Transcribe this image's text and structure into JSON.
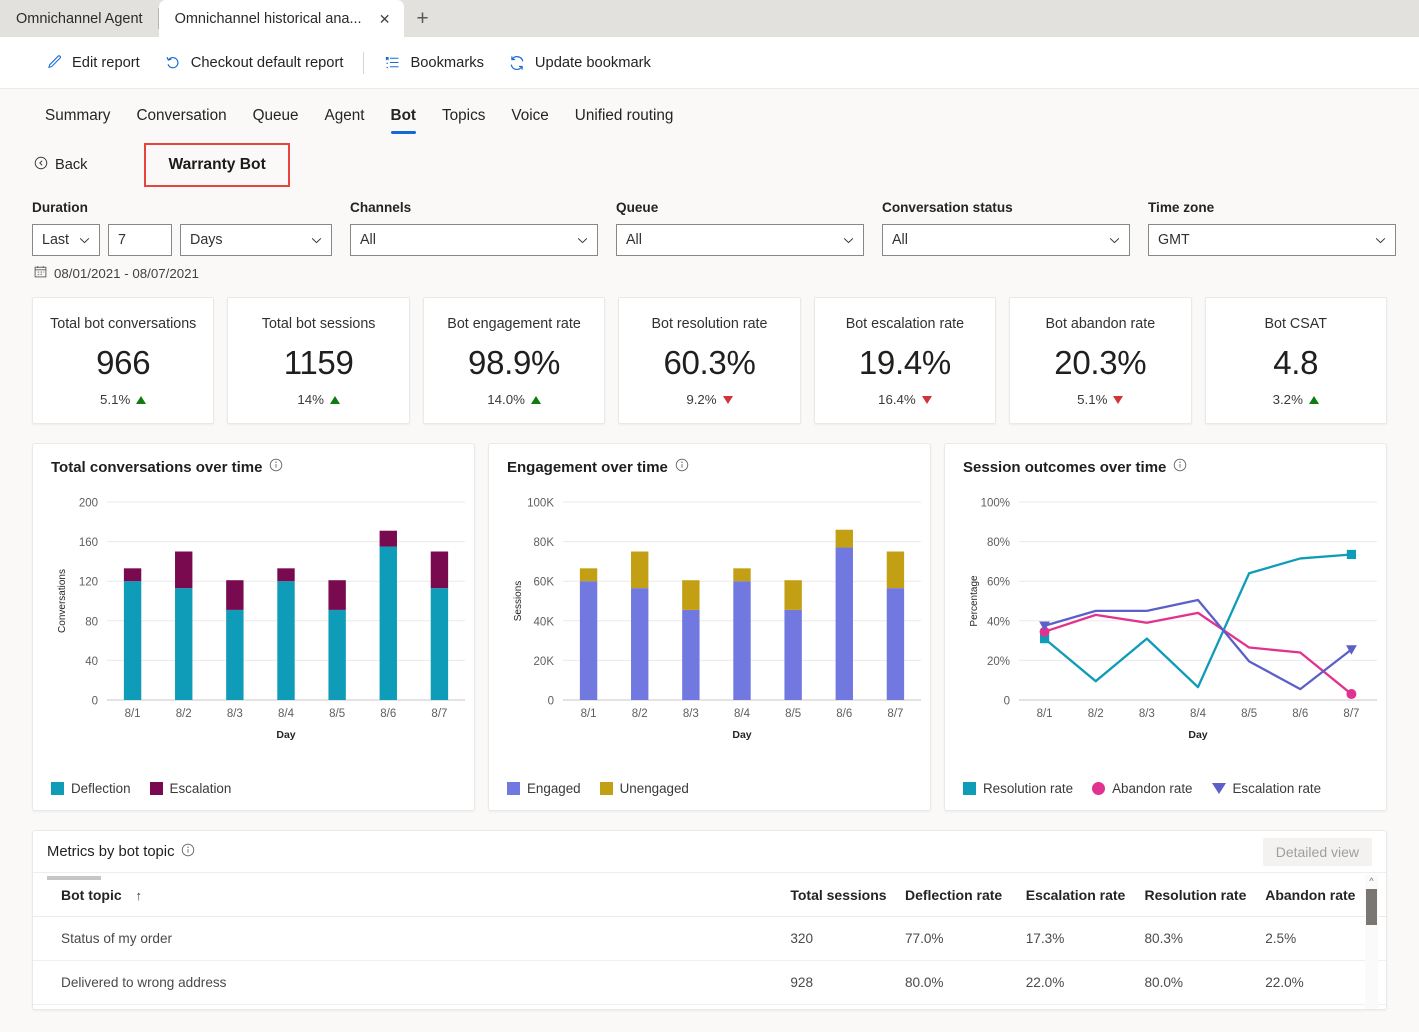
{
  "browser": {
    "tabs": [
      {
        "title": "Omnichannel Agent",
        "active": false
      },
      {
        "title": "Omnichannel historical ana...",
        "active": true
      }
    ],
    "close_label": "✕",
    "newtab_label": "+"
  },
  "command_bar": {
    "items": [
      {
        "label": "Edit report",
        "icon": "pencil-icon"
      },
      {
        "label": "Checkout default report",
        "icon": "undo-icon"
      },
      {
        "label": "Bookmarks",
        "icon": "bookmark-list-icon"
      },
      {
        "label": "Update bookmark",
        "icon": "refresh-icon"
      }
    ]
  },
  "nav_tabs": [
    {
      "label": "Summary",
      "selected": false
    },
    {
      "label": "Conversation",
      "selected": false
    },
    {
      "label": "Queue",
      "selected": false
    },
    {
      "label": "Agent",
      "selected": false
    },
    {
      "label": "Bot",
      "selected": true
    },
    {
      "label": "Topics",
      "selected": false
    },
    {
      "label": "Voice",
      "selected": false
    },
    {
      "label": "Unified routing",
      "selected": false
    }
  ],
  "breadcrumb": {
    "back_label": "Back",
    "bot_name": "Warranty Bot",
    "highlight_color": "#e8443f"
  },
  "filters": {
    "duration": {
      "label": "Duration",
      "mode": "Last",
      "amount": "7",
      "unit": "Days",
      "date_range": "08/01/2021 - 08/07/2021"
    },
    "channels": {
      "label": "Channels",
      "value": "All"
    },
    "queue": {
      "label": "Queue",
      "value": "All"
    },
    "conversation_status": {
      "label": "Conversation status",
      "value": "All"
    },
    "time_zone": {
      "label": "Time zone",
      "value": "GMT"
    }
  },
  "kpis": [
    {
      "label": "Total bot conversations",
      "value": "966",
      "delta": "5.1%",
      "direction": "up"
    },
    {
      "label": "Total bot sessions",
      "value": "1159",
      "delta": "14%",
      "direction": "up"
    },
    {
      "label": "Bot engagement rate",
      "value": "98.9%",
      "delta": "14.0%",
      "direction": "up"
    },
    {
      "label": "Bot resolution rate",
      "value": "60.3%",
      "delta": "9.2%",
      "direction": "down"
    },
    {
      "label": "Bot escalation rate",
      "value": "19.4%",
      "delta": "16.4%",
      "direction": "down"
    },
    {
      "label": "Bot abandon rate",
      "value": "20.3%",
      "delta": "5.1%",
      "direction": "down"
    },
    {
      "label": "Bot CSAT",
      "value": "4.8",
      "delta": "3.2%",
      "direction": "up"
    }
  ],
  "colors": {
    "accent_blue": "#1668d6",
    "deflection": "#0f9cb8",
    "escalation_bar": "#7a0a50",
    "engaged": "#7178e0",
    "unengaged": "#c3a013",
    "resolution": "#0f9cb8",
    "abandon": "#e2328f",
    "escalation_line": "#5b5fc7",
    "up": "#107c10",
    "down": "#d13438"
  },
  "chart_data": [
    {
      "type": "bar",
      "stacked": true,
      "title": "Total conversations over time",
      "info_tooltip": "info-icon",
      "xlabel": "Day",
      "ylabel": "Conversations",
      "categories": [
        "8/1",
        "8/2",
        "8/3",
        "8/4",
        "8/5",
        "8/6",
        "8/7"
      ],
      "ylim": [
        0,
        200
      ],
      "yticks": [
        0,
        40,
        80,
        120,
        160,
        200
      ],
      "grid": true,
      "legend_position": "bottom-left",
      "series": [
        {
          "name": "Deflection",
          "color": "#0f9cb8",
          "values": [
            120,
            113,
            91,
            120,
            91,
            155,
            113
          ]
        },
        {
          "name": "Escalation",
          "color": "#7a0a50",
          "values": [
            13,
            37,
            30,
            13,
            30,
            16,
            37
          ]
        }
      ],
      "totals": [
        133,
        150,
        121,
        133,
        121,
        171,
        150
      ]
    },
    {
      "type": "bar",
      "stacked": true,
      "title": "Engagement over time",
      "info_tooltip": "info-icon",
      "xlabel": "Day",
      "ylabel": "Sessions",
      "categories": [
        "8/1",
        "8/2",
        "8/3",
        "8/4",
        "8/5",
        "8/6",
        "8/7"
      ],
      "ylim": [
        0,
        100000
      ],
      "yticks": [
        0,
        20000,
        40000,
        60000,
        80000,
        100000
      ],
      "ytick_labels": [
        "0",
        "20K",
        "40K",
        "60K",
        "80K",
        "100K"
      ],
      "grid": true,
      "legend_position": "bottom-left",
      "series": [
        {
          "name": "Engaged",
          "color": "#7178e0",
          "values": [
            60000,
            56500,
            45500,
            60000,
            45500,
            77000,
            56500
          ]
        },
        {
          "name": "Unengaged",
          "color": "#c3a013",
          "values": [
            6500,
            18500,
            15000,
            6500,
            15000,
            9000,
            18500
          ]
        }
      ],
      "totals": [
        66500,
        75000,
        60500,
        66500,
        60500,
        86000,
        75000
      ]
    },
    {
      "type": "line",
      "title": "Session outcomes over time",
      "info_tooltip": "info-icon",
      "xlabel": "Day",
      "ylabel": "Percentage",
      "categories": [
        "8/1",
        "8/2",
        "8/3",
        "8/4",
        "8/5",
        "8/6",
        "8/7"
      ],
      "ylim": [
        0,
        100
      ],
      "yticks": [
        0,
        20,
        40,
        60,
        80,
        100
      ],
      "ytick_labels": [
        "0",
        "20%",
        "40%",
        "60%",
        "80%",
        "100%"
      ],
      "grid": true,
      "legend_position": "bottom-left",
      "series": [
        {
          "name": "Resolution rate",
          "color": "#0f9cb8",
          "marker": "square",
          "values": [
            31,
            9.5,
            31,
            6.5,
            64,
            71.5,
            73.5
          ]
        },
        {
          "name": "Abandon rate",
          "color": "#e2328f",
          "marker": "circle",
          "values": [
            34.5,
            43,
            39,
            44,
            26.5,
            24,
            3
          ]
        },
        {
          "name": "Escalation rate",
          "color": "#5b5fc7",
          "marker": "triangle-down",
          "values": [
            37.5,
            45,
            45,
            50.5,
            19.5,
            5.5,
            25.5
          ]
        }
      ]
    }
  ],
  "table": {
    "title": "Metrics by bot topic",
    "detailed_view_label": "Detailed view",
    "sort_column": "Bot topic",
    "sort_direction": "↑",
    "columns": [
      "Bot topic",
      "Total sessions",
      "Deflection rate",
      "Escalation rate",
      "Resolution rate",
      "Abandon rate"
    ],
    "rows": [
      {
        "topic": "Status of my order",
        "total_sessions": "320",
        "deflection_rate": "77.0%",
        "escalation_rate": "17.3%",
        "resolution_rate": "80.3%",
        "abandon_rate": "2.5%"
      },
      {
        "topic": "Delivered to wrong address",
        "total_sessions": "928",
        "deflection_rate": "80.0%",
        "escalation_rate": "22.0%",
        "resolution_rate": "80.0%",
        "abandon_rate": "22.0%"
      }
    ]
  }
}
